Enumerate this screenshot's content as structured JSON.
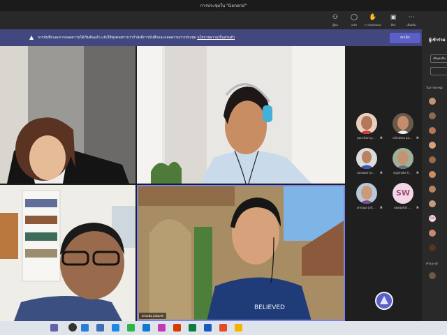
{
  "window": {
    "title": "การประชุมใน \"General\""
  },
  "toolbar": {
    "buttons": [
      {
        "label": "ผู้คน",
        "icon": "people-icon"
      },
      {
        "label": "แชท",
        "icon": "chat-icon"
      },
      {
        "label": "การตอบสนอง",
        "icon": "reactions-icon"
      },
      {
        "label": "ห้อง",
        "icon": "rooms-icon"
      },
      {
        "label": "เพิ่มเติม",
        "icon": "more-icon"
      }
    ]
  },
  "banner": {
    "message": "การบันทึกและการถอดความได้เริ่มต้นแล้ว แจ้งให้ทุกคนทราบว่ากำลังมีการบันทึกและถอดความการประชุม",
    "link": "นโยบายความเป็นส่วนตัว",
    "button": "ยกเลิก"
  },
  "tiles": [
    {
      "name": ""
    },
    {
      "name": ""
    },
    {
      "name": ""
    },
    {
      "name": "krisada yokaret"
    }
  ],
  "gallery": [
    {
      "name": "panchart p...",
      "avatar": "photo"
    },
    {
      "name": "chintana pa...",
      "avatar": "photo"
    },
    {
      "name": "sarawut lor...",
      "avatar": "photo"
    },
    {
      "name": "vigsinobs li...",
      "avatar": "photo"
    },
    {
      "name": "onnapa jod...",
      "avatar": "photo"
    },
    {
      "name": "sawaphat ...",
      "initials": "SW"
    }
  ],
  "right_panel": {
    "title": "ผู้เข้าร่วม",
    "share_label": "เชิญคนอื่น",
    "section_in_meeting": "ในการประชุม",
    "section_others": "คำแนะนำ",
    "initials_entry": "SW"
  },
  "colors": {
    "accent": "#5b5fc7",
    "banner": "#42487f",
    "active_border": "#7b83eb"
  }
}
